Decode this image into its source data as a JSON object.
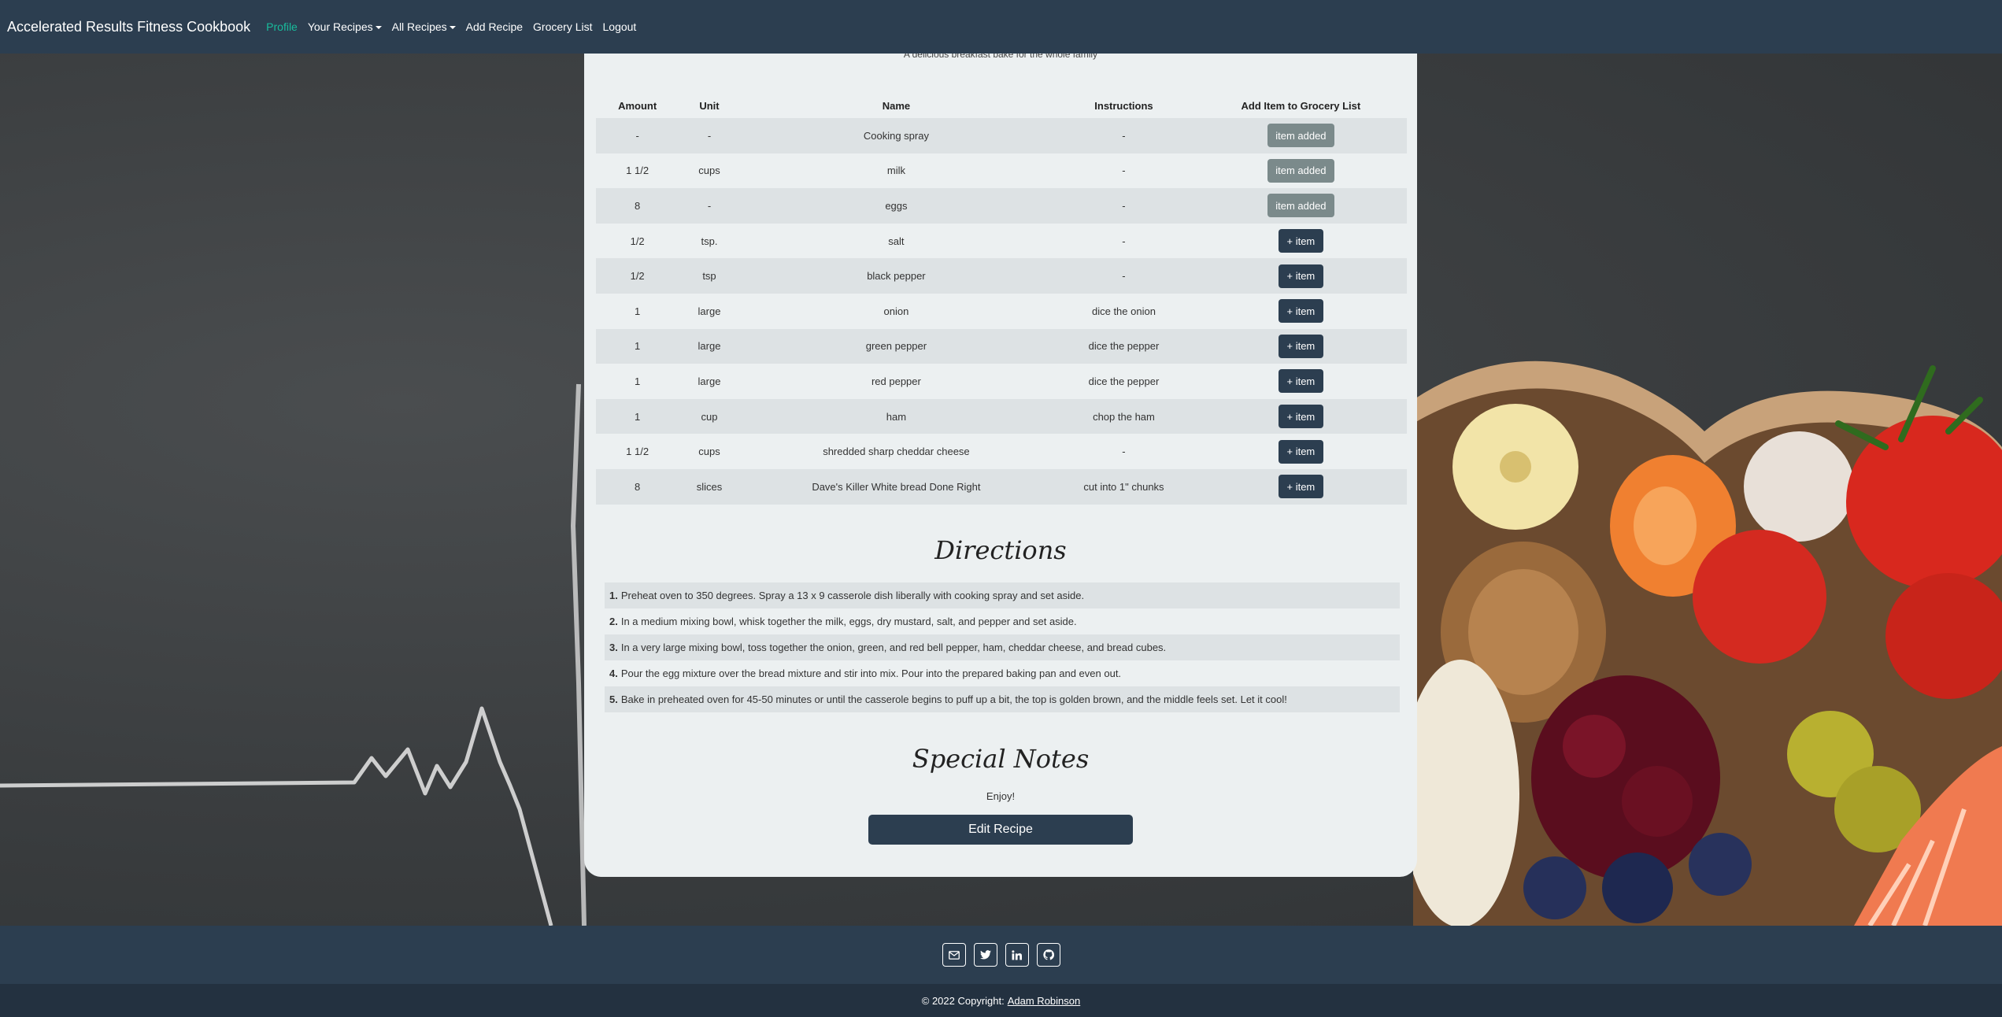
{
  "nav": {
    "brand": "Accelerated Results Fitness Cookbook",
    "items": [
      {
        "label": "Profile"
      },
      {
        "label": "Your Recipes"
      },
      {
        "label": "All Recipes"
      },
      {
        "label": "Add Recipe"
      },
      {
        "label": "Grocery List"
      },
      {
        "label": "Logout"
      }
    ],
    "active_color": "#18bc9c"
  },
  "recipe": {
    "subtitle": "A delicious breakfast bake for the whole family"
  },
  "ingredients": {
    "headers": [
      "Amount",
      "Unit",
      "Name",
      "Instructions",
      "Add Item to Grocery List"
    ],
    "rows": [
      {
        "amount": "-",
        "unit": "-",
        "name": "Cooking spray",
        "instructions": "-",
        "action": "item added"
      },
      {
        "amount": "1 1/2",
        "unit": "cups",
        "name": "milk",
        "instructions": "-",
        "action": "item added"
      },
      {
        "amount": "8",
        "unit": "-",
        "name": "eggs",
        "instructions": "-",
        "action": "item added"
      },
      {
        "amount": "1/2",
        "unit": "tsp.",
        "name": "salt",
        "instructions": "-",
        "action": "+ item"
      },
      {
        "amount": "1/2",
        "unit": "tsp",
        "name": "black pepper",
        "instructions": "-",
        "action": "+ item"
      },
      {
        "amount": "1",
        "unit": "large",
        "name": "onion",
        "instructions": "dice the onion",
        "action": "+ item"
      },
      {
        "amount": "1",
        "unit": "large",
        "name": "green pepper",
        "instructions": "dice the pepper",
        "action": "+ item"
      },
      {
        "amount": "1",
        "unit": "large",
        "name": "red pepper",
        "instructions": "dice the pepper",
        "action": "+ item"
      },
      {
        "amount": "1",
        "unit": "cup",
        "name": "ham",
        "instructions": "chop the ham",
        "action": "+ item"
      },
      {
        "amount": "1 1/2",
        "unit": "cups",
        "name": "shredded sharp cheddar cheese",
        "instructions": "-",
        "action": "+ item"
      },
      {
        "amount": "8",
        "unit": "slices",
        "name": "Dave's Killer White bread Done Right",
        "instructions": "cut into 1\" chunks",
        "action": "+ item"
      }
    ]
  },
  "directions": {
    "title": "Directions",
    "steps": [
      {
        "num": "1.",
        "text": "Preheat oven to 350 degrees. Spray a 13 x 9 casserole dish liberally with cooking spray and set aside."
      },
      {
        "num": "2.",
        "text": "In a medium mixing bowl, whisk together the milk, eggs, dry mustard, salt, and pepper and set aside."
      },
      {
        "num": "3.",
        "text": "In a very large mixing bowl, toss together the onion, green, and red bell pepper, ham, cheddar cheese, and bread cubes."
      },
      {
        "num": "4.",
        "text": "Pour the egg mixture over the bread mixture and stir into mix. Pour into the prepared baking pan and even out."
      },
      {
        "num": "5.",
        "text": "Bake in preheated oven for 45-50 minutes or until the casserole begins to puff up a bit, the top is golden brown, and the middle feels set. Let it cool!"
      }
    ]
  },
  "notes": {
    "title": "Special Notes",
    "text": "Enjoy!"
  },
  "edit_button": "Edit Recipe",
  "footer": {
    "social_icons": [
      "envelope-icon",
      "twitter-icon",
      "linkedin-icon",
      "github-icon"
    ],
    "copyright": "© 2022 Copyright:",
    "author": "Adam Robinson"
  },
  "colors": {
    "navbar": "#2c3e50",
    "card": "#ecf0f1",
    "added_button": "#7b8a8b",
    "item_button": "#2c3e50"
  }
}
